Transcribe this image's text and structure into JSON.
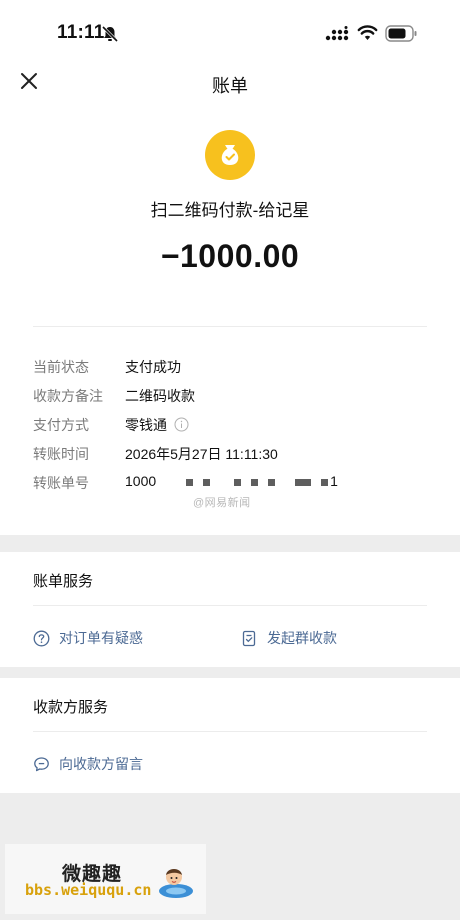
{
  "status_bar": {
    "time": "11:11"
  },
  "nav": {
    "title": "账单"
  },
  "transaction": {
    "title": "扫二维码付款-给记星",
    "amount": "−1000.00",
    "icon": "money-bag-icon",
    "accent_color": "#f7c11e"
  },
  "details": [
    {
      "label": "当前状态",
      "value": "支付成功"
    },
    {
      "label": "收款方备注",
      "value": "二维码收款"
    },
    {
      "label": "支付方式",
      "value": "零钱通"
    },
    {
      "label": "转账时间",
      "value": "2026年5月27日 11:11:30"
    },
    {
      "label": "转账单号",
      "value": "1000",
      "value_suffix": "1"
    }
  ],
  "watermark": "@网易新闻",
  "bill_service": {
    "title": "账单服务",
    "actions": [
      "对订单有疑惑",
      "发起群收款"
    ]
  },
  "payee_service": {
    "title": "收款方服务",
    "actions": [
      "向收款方留言"
    ]
  },
  "footer": {
    "site_name": "微趣趣",
    "site_url": "bbs.weiququ.cn"
  },
  "colors": {
    "link": "#4c6a94",
    "label": "#7a7a7a",
    "page_background": "#ededed"
  }
}
